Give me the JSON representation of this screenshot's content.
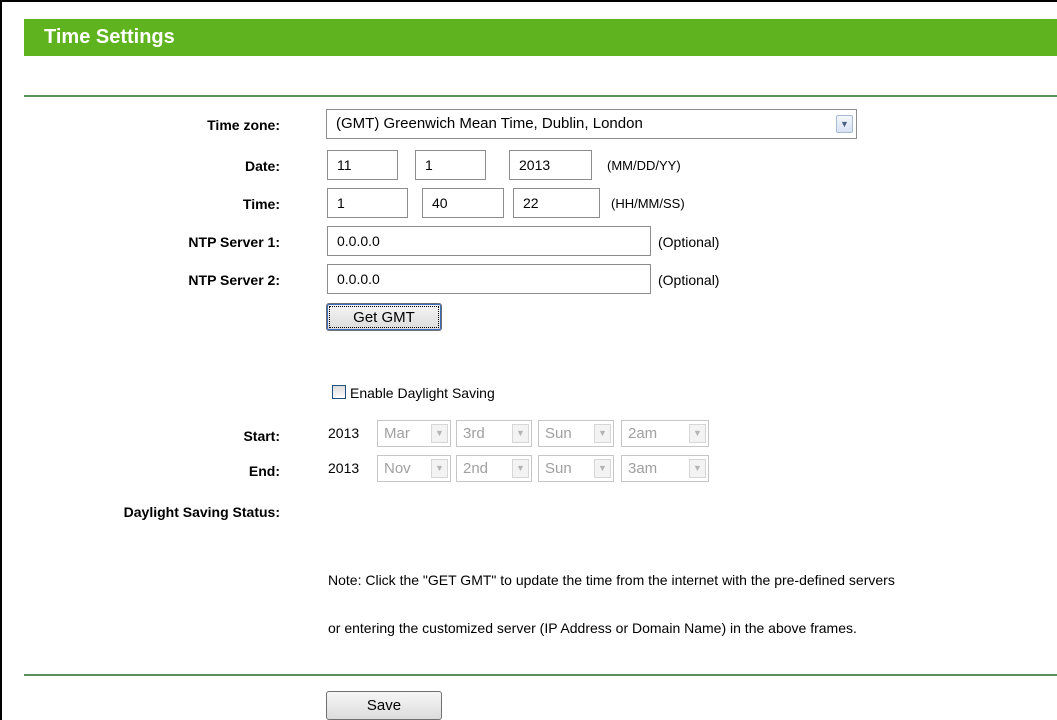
{
  "header": {
    "title": "Time Settings"
  },
  "form": {
    "time_zone": {
      "label": "Time zone:",
      "value": "(GMT) Greenwich Mean Time, Dublin, London"
    },
    "date": {
      "label": "Date:",
      "month": "11",
      "day": "1",
      "year": "2013",
      "hint": "(MM/DD/YY)"
    },
    "time": {
      "label": "Time:",
      "hour": "1",
      "minute": "40",
      "second": "22",
      "hint": "(HH/MM/SS)"
    },
    "ntp1": {
      "label": "NTP Server 1:",
      "value": "0.0.0.0",
      "hint": "(Optional)"
    },
    "ntp2": {
      "label": "NTP Server 2:",
      "value": "0.0.0.0",
      "hint": "(Optional)"
    },
    "get_gmt_label": "Get GMT"
  },
  "daylight": {
    "enable_label": "Enable Daylight Saving",
    "enabled": false,
    "start": {
      "label": "Start:",
      "year": "2013",
      "month": "Mar",
      "week": "3rd",
      "day": "Sun",
      "hour": "2am"
    },
    "end": {
      "label": "End:",
      "year": "2013",
      "month": "Nov",
      "week": "2nd",
      "day": "Sun",
      "hour": "3am"
    },
    "status_label": "Daylight Saving Status:"
  },
  "note": {
    "line1": "Note: Click the \"GET GMT\" to update the time from the internet with the pre-defined servers",
    "line2": "or entering the customized server (IP Address or Domain Name) in the above frames."
  },
  "actions": {
    "save_label": "Save"
  },
  "colors": {
    "header_bg": "#5fb31f",
    "divider": "#5a8f5a"
  }
}
